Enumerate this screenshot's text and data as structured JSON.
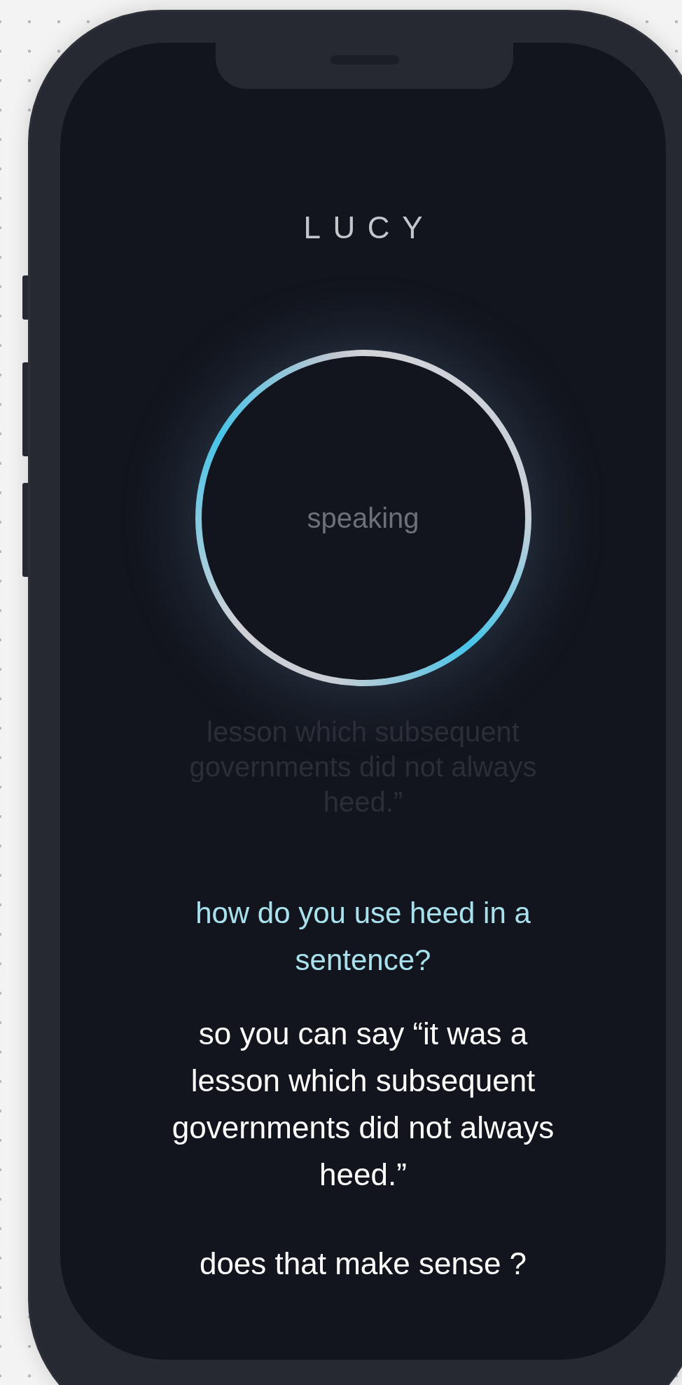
{
  "app_title": "LUCY",
  "orb": {
    "status": "speaking"
  },
  "previous_reply": "lesson which subsequent governments did not always heed.”",
  "question": "how do you use heed in a sentence?",
  "answer": [
    "so you can say “it was a lesson which subsequent governments did not always heed.”",
    "does that make sense ?"
  ]
}
